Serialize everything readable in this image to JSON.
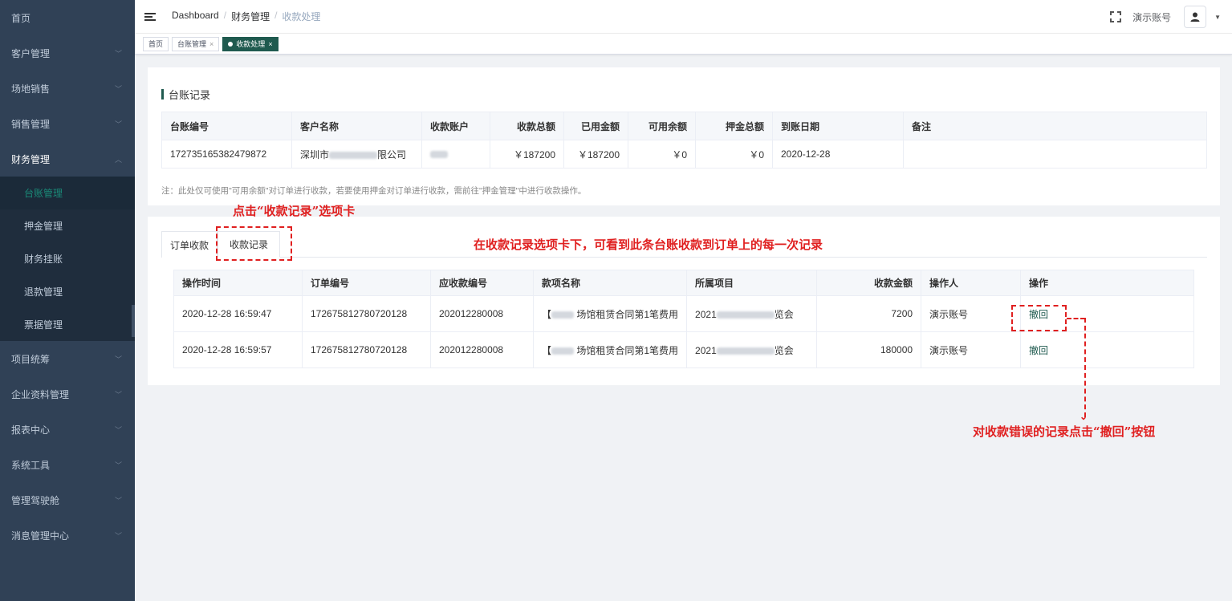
{
  "sidebar": {
    "items": [
      {
        "label": "首页"
      },
      {
        "label": "客户管理"
      },
      {
        "label": "场地销售"
      },
      {
        "label": "销售管理"
      },
      {
        "label": "财务管理"
      },
      {
        "label": "项目统筹"
      },
      {
        "label": "企业资料管理"
      },
      {
        "label": "报表中心"
      },
      {
        "label": "系统工具"
      },
      {
        "label": "管理驾驶舱"
      },
      {
        "label": "消息管理中心"
      }
    ],
    "finance_sub": [
      {
        "label": "台账管理"
      },
      {
        "label": "押金管理"
      },
      {
        "label": "财务挂账"
      },
      {
        "label": "退款管理"
      },
      {
        "label": "票据管理"
      }
    ]
  },
  "header": {
    "crumb1": "Dashboard",
    "crumb2": "财务管理",
    "crumb3": "收款处理",
    "sep": "/",
    "user": "演示账号"
  },
  "tags": {
    "home": "首页",
    "ledger": "台账管理",
    "current": "收款处理",
    "close": "×"
  },
  "ledger": {
    "title": "台账记录",
    "headers": [
      "台账编号",
      "客户名称",
      "收款账户",
      "收款总额",
      "已用金额",
      "可用余额",
      "押金总额",
      "到账日期",
      "备注"
    ],
    "row": {
      "no": "172735165382479872",
      "customer_prefix": "深圳市",
      "customer_suffix": "限公司",
      "total": "￥187200",
      "used": "￥187200",
      "available": "￥0",
      "deposit": "￥0",
      "date": "2020-12-28",
      "remark": ""
    },
    "note": "注：此处仅可使用\"可用余额\"对订单进行收款，若要使用押金对订单进行收款，需前往\"押金管理\"中进行收款操作。"
  },
  "tabs": {
    "order": "订单收款",
    "records": "收款记录"
  },
  "records": {
    "headers": [
      "操作时间",
      "订单编号",
      "应收款编号",
      "款项名称",
      "所属项目",
      "收款金额",
      "操作人",
      "操作"
    ],
    "rows": [
      {
        "time": "2020-12-28 16:59:47",
        "order": "172675812780720128",
        "recv": "202012280008",
        "item_prefix": "【",
        "item": "场馆租赁合同第1笔费用",
        "proj_prefix": "2021",
        "proj_suffix": "览会",
        "amount": "7200",
        "operator": "演示账号",
        "action": "撤回"
      },
      {
        "time": "2020-12-28 16:59:57",
        "order": "172675812780720128",
        "recv": "202012280008",
        "item_prefix": "【",
        "item": "场馆租赁合同第1笔费用",
        "proj_prefix": "2021",
        "proj_suffix": "览会",
        "amount": "180000",
        "operator": "演示账号",
        "action": "撤回"
      }
    ]
  },
  "annotations": {
    "tab_hint": "点击“收款记录”选项卡",
    "records_hint": "在收款记录选项卡下，可看到此条台账收款到订单上的每一次记录",
    "revoke_hint": "对收款错误的记录点击“撤回”按钮"
  },
  "colors": {
    "sidebar_bg": "#304156",
    "accent": "#1f5a4f",
    "annotation": "#e02020"
  }
}
